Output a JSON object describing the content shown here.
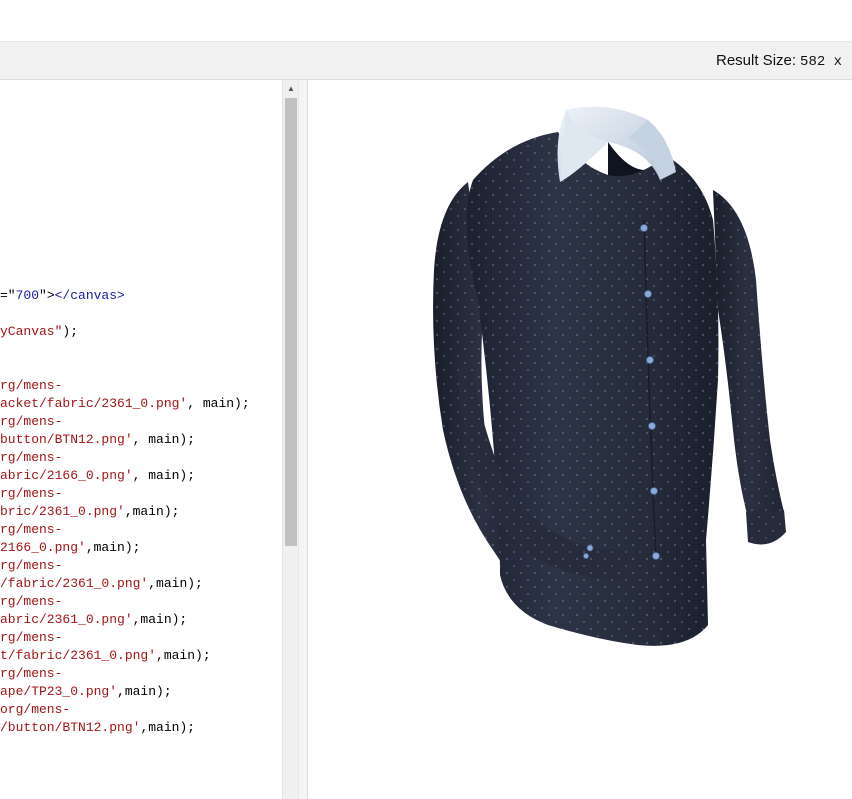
{
  "toolbar": {
    "result_label": "Result Size:",
    "result_value": "582 x"
  },
  "code_lines": [
    {
      "parts": [
        {
          "t": "plain",
          "v": "=\""
        },
        {
          "t": "tag",
          "v": "700"
        },
        {
          "t": "plain",
          "v": "\">"
        },
        {
          "t": "tag",
          "v": "</canvas>"
        }
      ]
    },
    {
      "parts": [
        {
          "t": "str",
          "v": "yCanvas\""
        },
        {
          "t": "plain",
          "v": ");"
        }
      ]
    },
    {
      "parts": [
        {
          "t": "str",
          "v": "rg/mens-"
        }
      ]
    },
    {
      "parts": [
        {
          "t": "str",
          "v": "acket/fabric/2361_0.png'"
        },
        {
          "t": "plain",
          "v": ", main);"
        }
      ]
    },
    {
      "parts": [
        {
          "t": "str",
          "v": "rg/mens-"
        }
      ]
    },
    {
      "parts": [
        {
          "t": "str",
          "v": "button/BTN12.png'"
        },
        {
          "t": "plain",
          "v": ", main);"
        }
      ]
    },
    {
      "parts": [
        {
          "t": "str",
          "v": "rg/mens-"
        }
      ]
    },
    {
      "parts": [
        {
          "t": "str",
          "v": "abric/2166_0.png'"
        },
        {
          "t": "plain",
          "v": ", main);"
        }
      ]
    },
    {
      "parts": [
        {
          "t": "str",
          "v": "rg/mens-"
        }
      ]
    },
    {
      "parts": [
        {
          "t": "str",
          "v": "bric/2361_0.png'"
        },
        {
          "t": "plain",
          "v": ",main);"
        }
      ]
    },
    {
      "parts": [
        {
          "t": "str",
          "v": "rg/mens-"
        }
      ]
    },
    {
      "parts": [
        {
          "t": "str",
          "v": "2166_0.png'"
        },
        {
          "t": "plain",
          "v": ",main);"
        }
      ]
    },
    {
      "parts": [
        {
          "t": "str",
          "v": "rg/mens-"
        }
      ]
    },
    {
      "parts": [
        {
          "t": "str",
          "v": "/fabric/2361_0.png'"
        },
        {
          "t": "plain",
          "v": ",main);"
        }
      ]
    },
    {
      "parts": [
        {
          "t": "str",
          "v": "rg/mens-"
        }
      ]
    },
    {
      "parts": [
        {
          "t": "str",
          "v": "abric/2361_0.png'"
        },
        {
          "t": "plain",
          "v": ",main);"
        }
      ]
    },
    {
      "parts": [
        {
          "t": "str",
          "v": "rg/mens-"
        }
      ]
    },
    {
      "parts": [
        {
          "t": "str",
          "v": "t/fabric/2361_0.png'"
        },
        {
          "t": "plain",
          "v": ",main);"
        }
      ]
    },
    {
      "parts": [
        {
          "t": "str",
          "v": "rg/mens-"
        }
      ]
    },
    {
      "parts": [
        {
          "t": "str",
          "v": "ape/TP23_0.png'"
        },
        {
          "t": "plain",
          "v": ",main);"
        }
      ]
    },
    {
      "parts": [
        {
          "t": "str",
          "v": "org/mens-"
        }
      ]
    },
    {
      "parts": [
        {
          "t": "str",
          "v": "/button/BTN12.png'"
        },
        {
          "t": "plain",
          "v": ",main);"
        }
      ]
    }
  ],
  "colors": {
    "string": "#a31515",
    "tag": "#1a1aa6",
    "shirt": "#2a3040",
    "collar": "#d8e2ee",
    "button": "#7f9fd0"
  },
  "icons": {
    "scroll_up": "triangle-up"
  }
}
